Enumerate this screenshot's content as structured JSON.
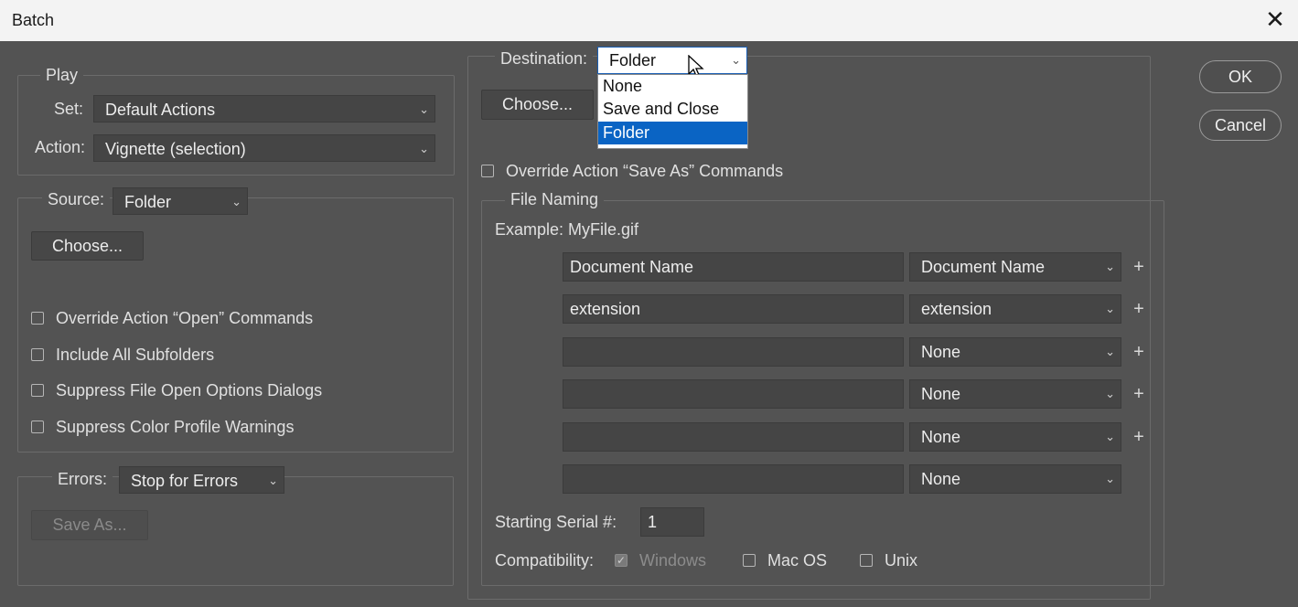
{
  "window": {
    "title": "Batch",
    "close_glyph": "✕"
  },
  "buttons": {
    "ok": "OK",
    "cancel": "Cancel"
  },
  "play": {
    "legend": "Play",
    "set_label": "Set:",
    "set_value": "Default Actions",
    "action_label": "Action:",
    "action_value": "Vignette (selection)"
  },
  "source": {
    "label": "Source:",
    "value": "Folder",
    "choose": "Choose...",
    "checkboxes": [
      "Override Action “Open” Commands",
      "Include All Subfolders",
      "Suppress File Open Options Dialogs",
      "Suppress Color Profile Warnings"
    ]
  },
  "errors": {
    "label": "Errors:",
    "value": "Stop for Errors",
    "save_as": "Save As..."
  },
  "destination": {
    "label": "Destination:",
    "value": "Folder",
    "options": [
      "None",
      "Save and Close",
      "Folder"
    ],
    "selected_option": "Folder",
    "choose": "Choose...",
    "override": "Override Action “Save As” Commands"
  },
  "file_naming": {
    "legend": "File Naming",
    "example": "Example: MyFile.gif",
    "rows": [
      {
        "text": "Document Name",
        "select": "Document Name",
        "plus": "+"
      },
      {
        "text": "extension",
        "select": "extension",
        "plus": "+"
      },
      {
        "text": "",
        "select": "None",
        "plus": "+"
      },
      {
        "text": "",
        "select": "None",
        "plus": "+"
      },
      {
        "text": "",
        "select": "None",
        "plus": "+"
      },
      {
        "text": "",
        "select": "None",
        "plus": ""
      }
    ],
    "serial_label": "Starting Serial #:",
    "serial_value": "1",
    "compat_label": "Compatibility:",
    "compat": [
      {
        "label": "Windows",
        "checked": true,
        "disabled": true
      },
      {
        "label": "Mac OS",
        "checked": false,
        "disabled": false
      },
      {
        "label": "Unix",
        "checked": false,
        "disabled": false
      }
    ]
  },
  "icons": {
    "chevron": "⌄",
    "check": "✓"
  }
}
